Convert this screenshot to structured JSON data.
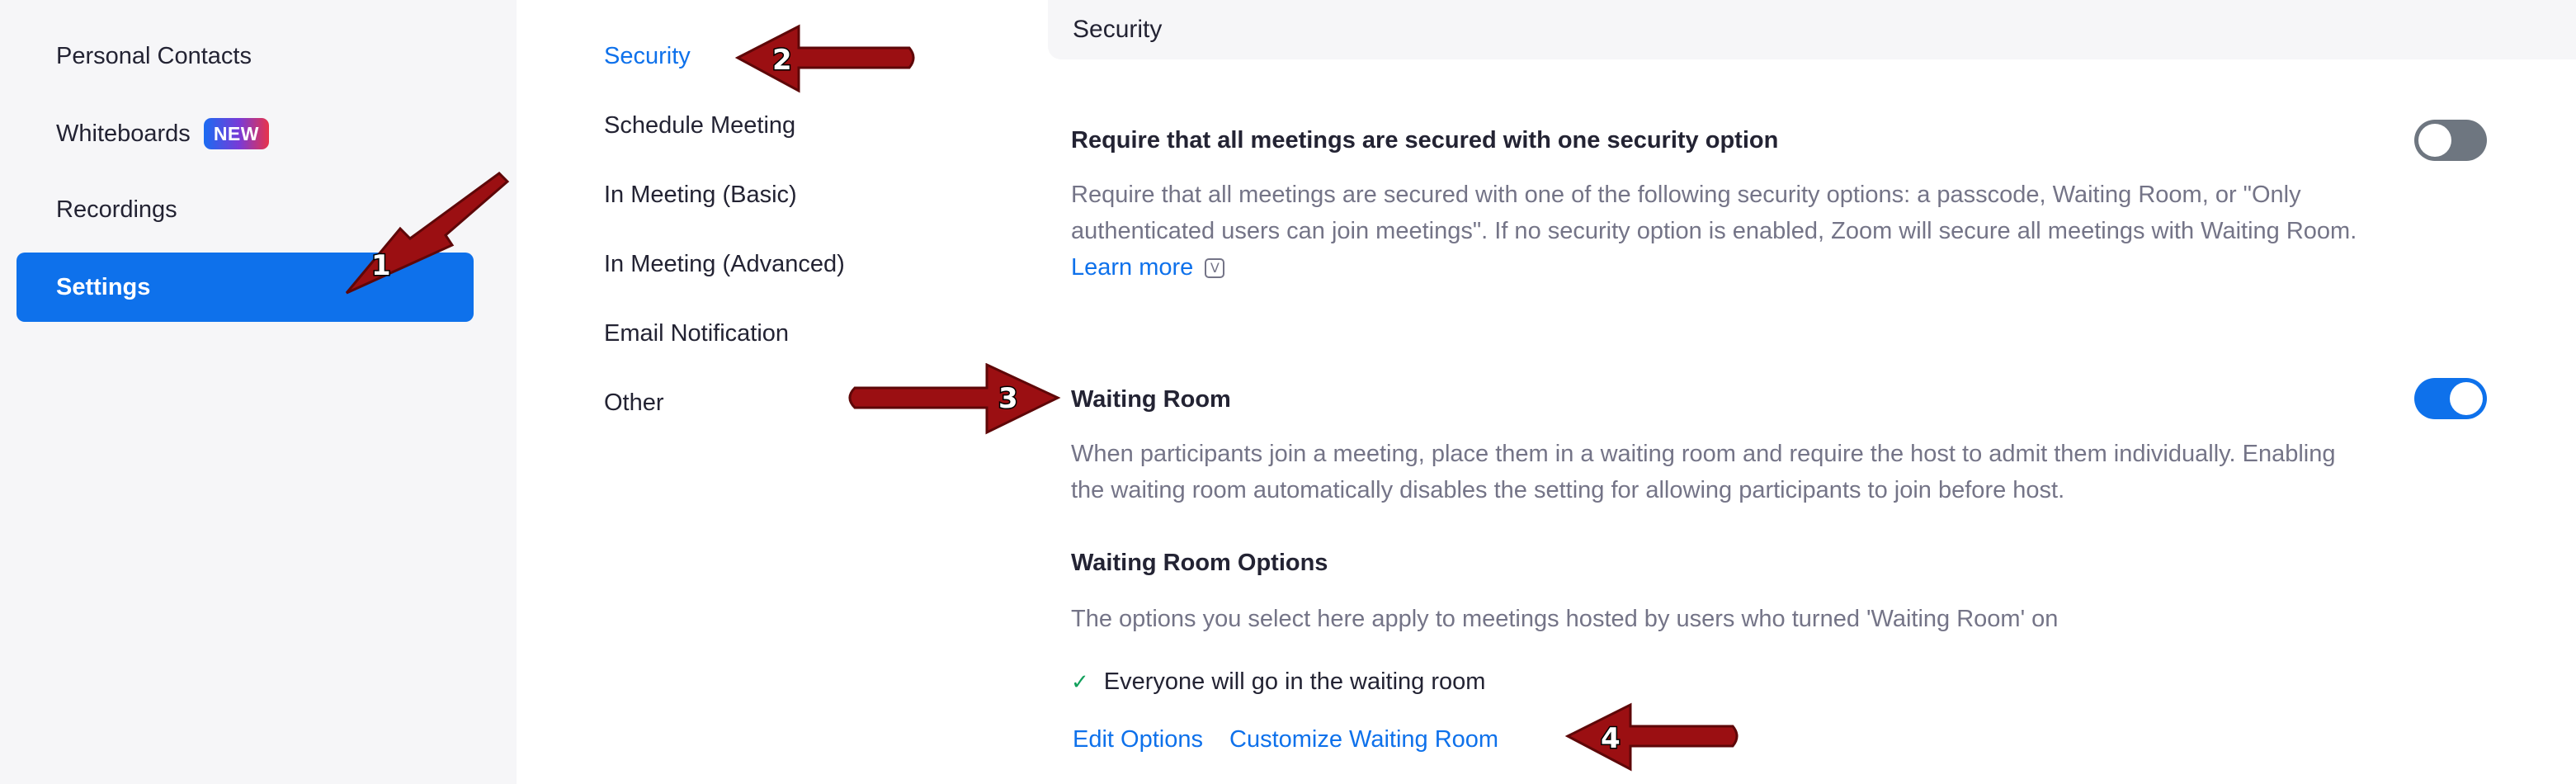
{
  "sidebar": {
    "items": [
      {
        "label": "Personal Contacts",
        "active": false
      },
      {
        "label": "Whiteboards",
        "badge": "NEW",
        "active": false
      },
      {
        "label": "Recordings",
        "active": false
      },
      {
        "label": "Settings",
        "active": true
      }
    ]
  },
  "section_nav": {
    "items": [
      {
        "label": "Security",
        "active": true
      },
      {
        "label": "Schedule Meeting",
        "active": false
      },
      {
        "label": "In Meeting (Basic)",
        "active": false
      },
      {
        "label": "In Meeting (Advanced)",
        "active": false
      },
      {
        "label": "Email Notification",
        "active": false
      },
      {
        "label": "Other",
        "active": false
      }
    ]
  },
  "main": {
    "section_title": "Security",
    "require_security": {
      "title": "Require that all meetings are secured with one security option",
      "description": "Require that all meetings are secured with one of the following security options: a passcode, Waiting Room, or \"Only authenticated users can join meetings\". If no security option is enabled, Zoom will secure all meetings with Waiting Room.",
      "learn_more": "Learn more",
      "info_icon_glyph": "V",
      "enabled": false
    },
    "waiting_room": {
      "title": "Waiting Room",
      "description": "When participants join a meeting, place them in a waiting room and require the host to admit them individually. Enabling the waiting room automatically disables the setting for allowing participants to join before host.",
      "enabled": true,
      "options_title": "Waiting Room Options",
      "options_description": "The options you select here apply to meetings hosted by users who turned 'Waiting Room' on",
      "selected_option": "Everyone will go in the waiting room",
      "edit_options": "Edit Options",
      "customize": "Customize Waiting Room"
    }
  },
  "annotations": [
    {
      "number": "1"
    },
    {
      "number": "2"
    },
    {
      "number": "3"
    },
    {
      "number": "4"
    }
  ],
  "colors": {
    "accent": "#0e71eb",
    "sidebar_bg": "#f6f6f8",
    "arrow": "#9b0f12",
    "toggle_off": "#6e7680",
    "check": "#12a05c"
  }
}
